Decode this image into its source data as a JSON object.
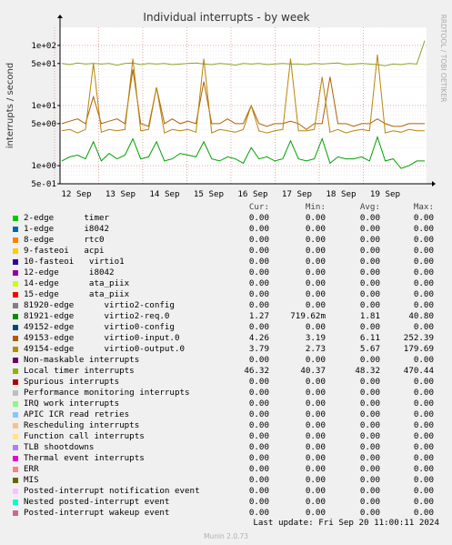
{
  "chart_data": {
    "type": "line",
    "title": "Individual interrupts - by week",
    "ylabel": "interrupts / second",
    "side_label": "RRDTOOL / TOBI OETIKER",
    "yscale": "log",
    "ylim": [
      0.5,
      200
    ],
    "y_ticks": [
      "1e+02",
      "5e+01",
      "1e+01",
      "5e+00",
      "1e+00",
      "5e-01"
    ],
    "y_tick_values": [
      100,
      50,
      10,
      5,
      1,
      0.5
    ],
    "x_ticks": [
      "12 Sep",
      "13 Sep",
      "14 Sep",
      "15 Sep",
      "16 Sep",
      "17 Sep",
      "18 Sep",
      "19 Sep"
    ],
    "series": [
      {
        "name": "Local timer interrupts",
        "color": "#8fa02a",
        "values": [
          50,
          48,
          51,
          49,
          50,
          49,
          50,
          47,
          50,
          51,
          48,
          50,
          49,
          50,
          48,
          49,
          50,
          51,
          49,
          48,
          50,
          49,
          47,
          50,
          49,
          50,
          48,
          49,
          50,
          49,
          49,
          48,
          50,
          49,
          50,
          51,
          48,
          49,
          50,
          49,
          48,
          46,
          49,
          48,
          50,
          49,
          120
        ]
      },
      {
        "name": "virtio0-input.0",
        "color": "#b06000",
        "values": [
          5,
          5.5,
          6,
          5,
          14,
          5,
          5.5,
          6,
          5,
          40,
          5,
          4.5,
          20,
          5,
          6,
          5,
          5.5,
          5,
          25,
          5,
          5,
          6,
          5,
          5,
          10,
          5,
          4.5,
          5,
          5,
          5.5,
          5,
          4,
          5,
          5,
          30,
          5,
          5,
          4.5,
          5,
          5,
          6,
          5,
          4.5,
          4.5,
          5,
          5,
          5
        ]
      },
      {
        "name": "virtio0-output.0",
        "color": "#b8860b",
        "values": [
          3.8,
          4,
          3.5,
          4,
          50,
          3.6,
          4,
          3.8,
          4,
          60,
          3.8,
          4,
          20,
          3.5,
          4,
          3.8,
          4,
          3.6,
          60,
          3.5,
          4,
          3.8,
          3.6,
          4,
          10,
          3.8,
          3.5,
          3.8,
          4,
          60,
          3.8,
          3.8,
          4,
          30,
          3.6,
          4,
          3.5,
          3.8,
          4,
          3.8,
          70,
          3.5,
          3.8,
          3.6,
          4,
          3.8,
          3.8
        ]
      },
      {
        "name": "virtio2-req.0",
        "color": "#00a000",
        "values": [
          1.2,
          1.4,
          1.5,
          1.3,
          2.5,
          1.2,
          1.6,
          1.3,
          1.5,
          2.8,
          1.3,
          1.4,
          2.5,
          1.2,
          1.3,
          1.6,
          1.5,
          1.4,
          2.5,
          1.3,
          1.2,
          1.4,
          1.3,
          1.1,
          2,
          1.3,
          1.4,
          1.2,
          1.3,
          2.6,
          1.3,
          1.2,
          1.3,
          2.8,
          1.1,
          1.4,
          1.3,
          1.3,
          1.4,
          1.2,
          3,
          1.2,
          1.3,
          0.9,
          1,
          1.2,
          1.2
        ]
      }
    ]
  },
  "legend": {
    "headers": [
      "Cur:",
      "Min:",
      "Avg:",
      "Max:"
    ],
    "rows": [
      {
        "label": "2-edge      timer",
        "color": "#00cc00",
        "cur": "0.00",
        "min": "0.00",
        "avg": "0.00",
        "max": "0.00"
      },
      {
        "label": "1-edge      i8042",
        "color": "#0066b3",
        "cur": "0.00",
        "min": "0.00",
        "avg": "0.00",
        "max": "0.00"
      },
      {
        "label": "8-edge      rtc0",
        "color": "#ff8000",
        "cur": "0.00",
        "min": "0.00",
        "avg": "0.00",
        "max": "0.00"
      },
      {
        "label": "9-fasteoi   acpi",
        "color": "#ffcc00",
        "cur": "0.00",
        "min": "0.00",
        "avg": "0.00",
        "max": "0.00"
      },
      {
        "label": "10-fasteoi   virtio1",
        "color": "#330099",
        "cur": "0.00",
        "min": "0.00",
        "avg": "0.00",
        "max": "0.00"
      },
      {
        "label": "12-edge      i8042",
        "color": "#990099",
        "cur": "0.00",
        "min": "0.00",
        "avg": "0.00",
        "max": "0.00"
      },
      {
        "label": "14-edge      ata_piix",
        "color": "#ccff00",
        "cur": "0.00",
        "min": "0.00",
        "avg": "0.00",
        "max": "0.00"
      },
      {
        "label": "15-edge      ata_piix",
        "color": "#ff0000",
        "cur": "0.00",
        "min": "0.00",
        "avg": "0.00",
        "max": "0.00"
      },
      {
        "label": "81920-edge      virtio2-config",
        "color": "#808080",
        "cur": "0.00",
        "min": "0.00",
        "avg": "0.00",
        "max": "0.00"
      },
      {
        "label": "81921-edge      virtio2-req.0",
        "color": "#008f00",
        "cur": "1.27",
        "min": "719.62m",
        "avg": "1.81",
        "max": "40.80"
      },
      {
        "label": "49152-edge      virtio0-config",
        "color": "#00487d",
        "cur": "0.00",
        "min": "0.00",
        "avg": "0.00",
        "max": "0.00"
      },
      {
        "label": "49153-edge      virtio0-input.0",
        "color": "#b35a00",
        "cur": "4.26",
        "min": "3.19",
        "avg": "6.11",
        "max": "252.39"
      },
      {
        "label": "49154-edge      virtio0-output.0",
        "color": "#b38f00",
        "cur": "3.79",
        "min": "2.73",
        "avg": "5.67",
        "max": "179.69"
      },
      {
        "label": "Non-maskable interrupts",
        "color": "#6b006b",
        "cur": "0.00",
        "min": "0.00",
        "avg": "0.00",
        "max": "0.00"
      },
      {
        "label": "Local timer interrupts",
        "color": "#8fb300",
        "cur": "46.32",
        "min": "40.37",
        "avg": "48.32",
        "max": "470.44"
      },
      {
        "label": "Spurious interrupts",
        "color": "#b30000",
        "cur": "0.00",
        "min": "0.00",
        "avg": "0.00",
        "max": "0.00"
      },
      {
        "label": "Performance monitoring interrupts",
        "color": "#bebebe",
        "cur": "0.00",
        "min": "0.00",
        "avg": "0.00",
        "max": "0.00"
      },
      {
        "label": "IRQ work interrupts",
        "color": "#80ff80",
        "cur": "0.00",
        "min": "0.00",
        "avg": "0.00",
        "max": "0.00"
      },
      {
        "label": "APIC ICR read retries",
        "color": "#80c9ff",
        "cur": "0.00",
        "min": "0.00",
        "avg": "0.00",
        "max": "0.00"
      },
      {
        "label": "Rescheduling interrupts",
        "color": "#ffc080",
        "cur": "0.00",
        "min": "0.00",
        "avg": "0.00",
        "max": "0.00"
      },
      {
        "label": "Function call interrupts",
        "color": "#ffe680",
        "cur": "0.00",
        "min": "0.00",
        "avg": "0.00",
        "max": "0.00"
      },
      {
        "label": "TLB shootdowns",
        "color": "#aa80ff",
        "cur": "0.00",
        "min": "0.00",
        "avg": "0.00",
        "max": "0.00"
      },
      {
        "label": "Thermal event interrupts",
        "color": "#ee00cc",
        "cur": "0.00",
        "min": "0.00",
        "avg": "0.00",
        "max": "0.00"
      },
      {
        "label": "ERR",
        "color": "#ff8080",
        "cur": "0.00",
        "min": "0.00",
        "avg": "0.00",
        "max": "0.00"
      },
      {
        "label": "MIS",
        "color": "#666600",
        "cur": "0.00",
        "min": "0.00",
        "avg": "0.00",
        "max": "0.00"
      },
      {
        "label": "Posted-interrupt notification event",
        "color": "#ffbfff",
        "cur": "0.00",
        "min": "0.00",
        "avg": "0.00",
        "max": "0.00"
      },
      {
        "label": "Nested posted-interrupt event",
        "color": "#00ffcc",
        "cur": "0.00",
        "min": "0.00",
        "avg": "0.00",
        "max": "0.00"
      },
      {
        "label": "Posted-interrupt wakeup event",
        "color": "#cc6699",
        "cur": "0.00",
        "min": "0.00",
        "avg": "0.00",
        "max": "0.00"
      }
    ]
  },
  "footer": {
    "last_update": "Last update: Fri Sep 20 11:00:11 2024",
    "munin": "Munin 2.0.73"
  }
}
